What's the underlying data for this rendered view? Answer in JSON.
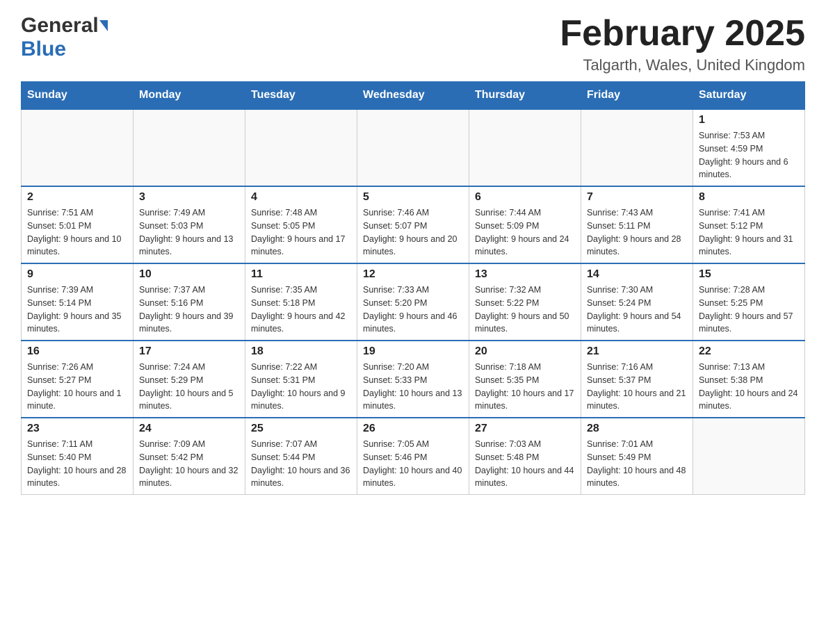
{
  "header": {
    "logo": {
      "general": "General",
      "arrow": "▶",
      "blue": "Blue"
    },
    "title": "February 2025",
    "location": "Talgarth, Wales, United Kingdom"
  },
  "calendar": {
    "weekdays": [
      "Sunday",
      "Monday",
      "Tuesday",
      "Wednesday",
      "Thursday",
      "Friday",
      "Saturday"
    ],
    "weeks": [
      [
        {
          "day": "",
          "info": ""
        },
        {
          "day": "",
          "info": ""
        },
        {
          "day": "",
          "info": ""
        },
        {
          "day": "",
          "info": ""
        },
        {
          "day": "",
          "info": ""
        },
        {
          "day": "",
          "info": ""
        },
        {
          "day": "1",
          "info": "Sunrise: 7:53 AM\nSunset: 4:59 PM\nDaylight: 9 hours and 6 minutes."
        }
      ],
      [
        {
          "day": "2",
          "info": "Sunrise: 7:51 AM\nSunset: 5:01 PM\nDaylight: 9 hours and 10 minutes."
        },
        {
          "day": "3",
          "info": "Sunrise: 7:49 AM\nSunset: 5:03 PM\nDaylight: 9 hours and 13 minutes."
        },
        {
          "day": "4",
          "info": "Sunrise: 7:48 AM\nSunset: 5:05 PM\nDaylight: 9 hours and 17 minutes."
        },
        {
          "day": "5",
          "info": "Sunrise: 7:46 AM\nSunset: 5:07 PM\nDaylight: 9 hours and 20 minutes."
        },
        {
          "day": "6",
          "info": "Sunrise: 7:44 AM\nSunset: 5:09 PM\nDaylight: 9 hours and 24 minutes."
        },
        {
          "day": "7",
          "info": "Sunrise: 7:43 AM\nSunset: 5:11 PM\nDaylight: 9 hours and 28 minutes."
        },
        {
          "day": "8",
          "info": "Sunrise: 7:41 AM\nSunset: 5:12 PM\nDaylight: 9 hours and 31 minutes."
        }
      ],
      [
        {
          "day": "9",
          "info": "Sunrise: 7:39 AM\nSunset: 5:14 PM\nDaylight: 9 hours and 35 minutes."
        },
        {
          "day": "10",
          "info": "Sunrise: 7:37 AM\nSunset: 5:16 PM\nDaylight: 9 hours and 39 minutes."
        },
        {
          "day": "11",
          "info": "Sunrise: 7:35 AM\nSunset: 5:18 PM\nDaylight: 9 hours and 42 minutes."
        },
        {
          "day": "12",
          "info": "Sunrise: 7:33 AM\nSunset: 5:20 PM\nDaylight: 9 hours and 46 minutes."
        },
        {
          "day": "13",
          "info": "Sunrise: 7:32 AM\nSunset: 5:22 PM\nDaylight: 9 hours and 50 minutes."
        },
        {
          "day": "14",
          "info": "Sunrise: 7:30 AM\nSunset: 5:24 PM\nDaylight: 9 hours and 54 minutes."
        },
        {
          "day": "15",
          "info": "Sunrise: 7:28 AM\nSunset: 5:25 PM\nDaylight: 9 hours and 57 minutes."
        }
      ],
      [
        {
          "day": "16",
          "info": "Sunrise: 7:26 AM\nSunset: 5:27 PM\nDaylight: 10 hours and 1 minute."
        },
        {
          "day": "17",
          "info": "Sunrise: 7:24 AM\nSunset: 5:29 PM\nDaylight: 10 hours and 5 minutes."
        },
        {
          "day": "18",
          "info": "Sunrise: 7:22 AM\nSunset: 5:31 PM\nDaylight: 10 hours and 9 minutes."
        },
        {
          "day": "19",
          "info": "Sunrise: 7:20 AM\nSunset: 5:33 PM\nDaylight: 10 hours and 13 minutes."
        },
        {
          "day": "20",
          "info": "Sunrise: 7:18 AM\nSunset: 5:35 PM\nDaylight: 10 hours and 17 minutes."
        },
        {
          "day": "21",
          "info": "Sunrise: 7:16 AM\nSunset: 5:37 PM\nDaylight: 10 hours and 21 minutes."
        },
        {
          "day": "22",
          "info": "Sunrise: 7:13 AM\nSunset: 5:38 PM\nDaylight: 10 hours and 24 minutes."
        }
      ],
      [
        {
          "day": "23",
          "info": "Sunrise: 7:11 AM\nSunset: 5:40 PM\nDaylight: 10 hours and 28 minutes."
        },
        {
          "day": "24",
          "info": "Sunrise: 7:09 AM\nSunset: 5:42 PM\nDaylight: 10 hours and 32 minutes."
        },
        {
          "day": "25",
          "info": "Sunrise: 7:07 AM\nSunset: 5:44 PM\nDaylight: 10 hours and 36 minutes."
        },
        {
          "day": "26",
          "info": "Sunrise: 7:05 AM\nSunset: 5:46 PM\nDaylight: 10 hours and 40 minutes."
        },
        {
          "day": "27",
          "info": "Sunrise: 7:03 AM\nSunset: 5:48 PM\nDaylight: 10 hours and 44 minutes."
        },
        {
          "day": "28",
          "info": "Sunrise: 7:01 AM\nSunset: 5:49 PM\nDaylight: 10 hours and 48 minutes."
        },
        {
          "day": "",
          "info": ""
        }
      ]
    ]
  }
}
